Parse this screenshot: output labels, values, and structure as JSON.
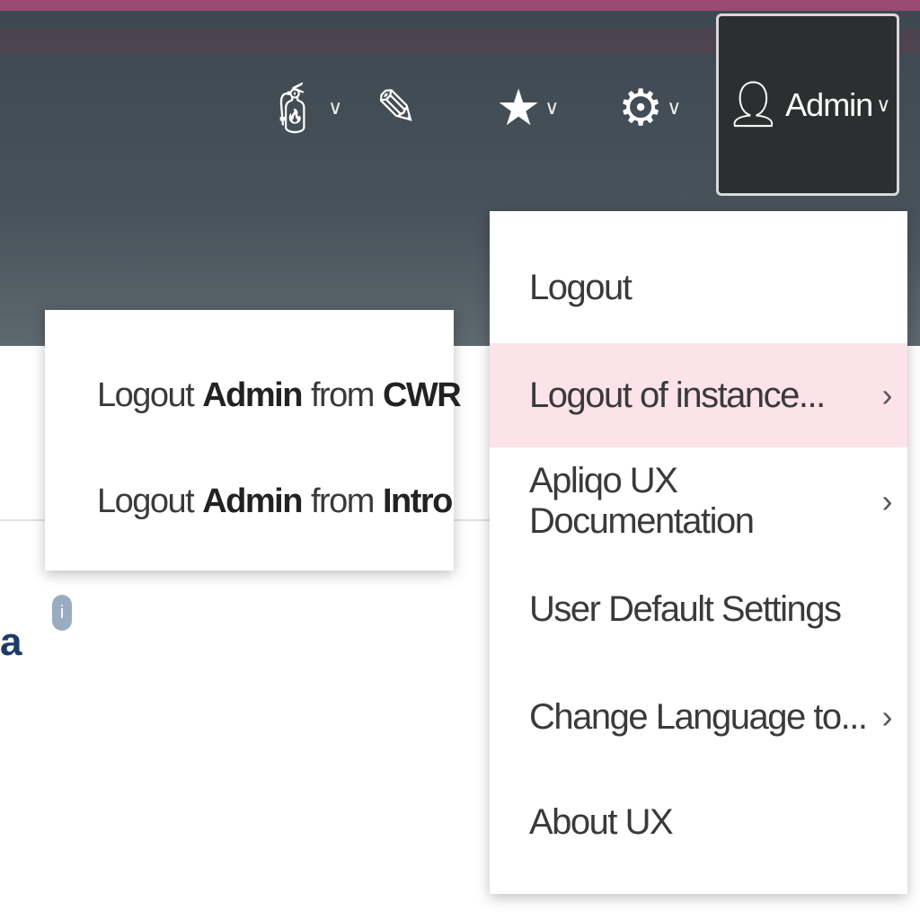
{
  "header": {
    "icons": [
      {
        "name": "fire-extinguisher-icon",
        "has_dropdown": true
      },
      {
        "name": "edit-icon",
        "has_dropdown": false
      },
      {
        "name": "star-icon",
        "has_dropdown": true
      },
      {
        "name": "gears-icon",
        "has_dropdown": true
      }
    ],
    "user_label": "Admin"
  },
  "user_menu": {
    "items": [
      {
        "label": "Logout",
        "submenu": false
      },
      {
        "label": "Logout of instance...",
        "submenu": true,
        "highlighted": true
      },
      {
        "label": "Apliqo UX Documentation",
        "submenu": true
      },
      {
        "label": "User Default Settings",
        "submenu": false
      },
      {
        "label": "Change Language to...",
        "submenu": true
      },
      {
        "label": "About UX",
        "submenu": false
      }
    ]
  },
  "submenu": {
    "items": [
      {
        "prefix": "Logout",
        "user": "Admin",
        "mid": "from",
        "instance": "CWR"
      },
      {
        "prefix": "Logout",
        "user": "Admin",
        "mid": "from",
        "instance": "Intro"
      }
    ]
  },
  "content": {
    "partial_text": "a",
    "info_icon": "i"
  },
  "colors": {
    "accent_strip": "#9a4a72",
    "highlight": "#fce3ea",
    "header": "#48525a"
  }
}
